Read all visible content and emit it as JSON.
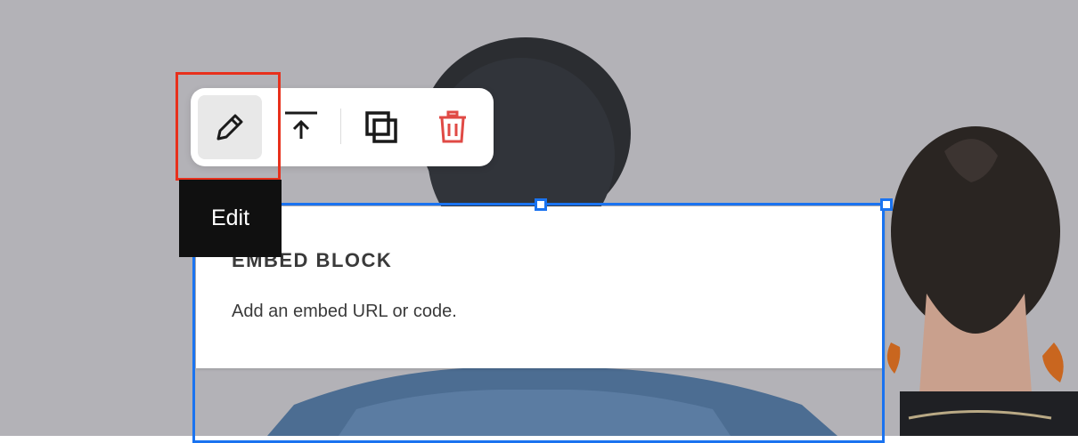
{
  "toolbar": {
    "buttons": [
      {
        "name": "edit",
        "icon": "pencil-icon"
      },
      {
        "name": "move",
        "icon": "arrow-up-to-line-icon"
      },
      {
        "name": "duplicate",
        "icon": "duplicate-icon"
      },
      {
        "name": "delete",
        "icon": "trash-icon"
      }
    ]
  },
  "tooltip": {
    "label": "Edit"
  },
  "block": {
    "title": "EMBED BLOCK",
    "description": "Add an embed URL or code."
  },
  "colors": {
    "selection": "#1a73f0",
    "highlight": "#e8301c",
    "delete": "#e04a45",
    "tooltip_bg": "#101010",
    "background": "#b0b0b4"
  }
}
